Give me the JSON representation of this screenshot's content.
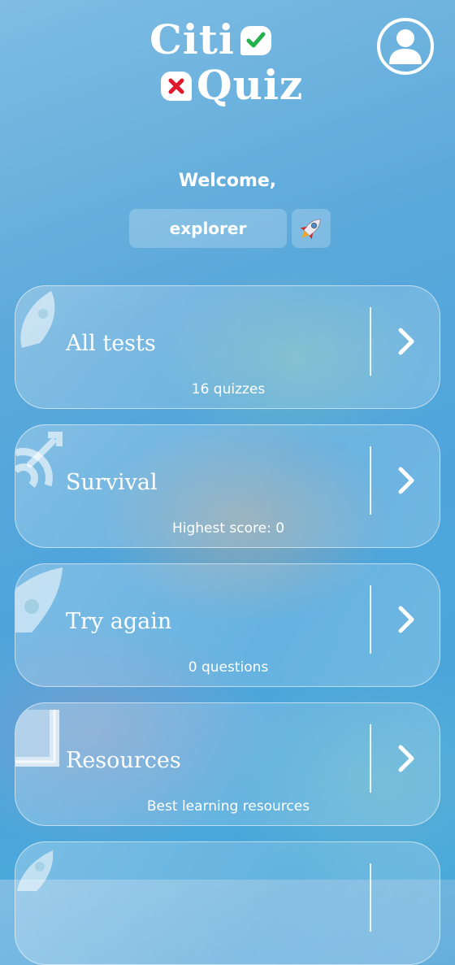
{
  "header": {
    "logo_line1": "Citi",
    "logo_line2": "Quiz",
    "logo_check_color": "#22b14c",
    "logo_cross_color": "#e0192a",
    "profile_icon": "user-icon"
  },
  "welcome": {
    "greeting": "Welcome,",
    "username": "explorer",
    "avatar_icon": "rocket-icon"
  },
  "cards": [
    {
      "title": "All tests",
      "subtitle": "16 quizzes",
      "icon": "rocket-icon"
    },
    {
      "title": "Survival",
      "subtitle": "Highest score: 0",
      "icon": "target-icon"
    },
    {
      "title": "Try again",
      "subtitle": "0 questions",
      "icon": "rocket-icon"
    },
    {
      "title": "Resources",
      "subtitle": "Best learning resources",
      "icon": "book-icon"
    },
    {
      "title": "",
      "subtitle": "",
      "icon": "rocket-icon"
    }
  ],
  "colors": {
    "background_top": "#7fbde3",
    "background_bottom": "#4aa8db",
    "text": "#ffffff"
  }
}
